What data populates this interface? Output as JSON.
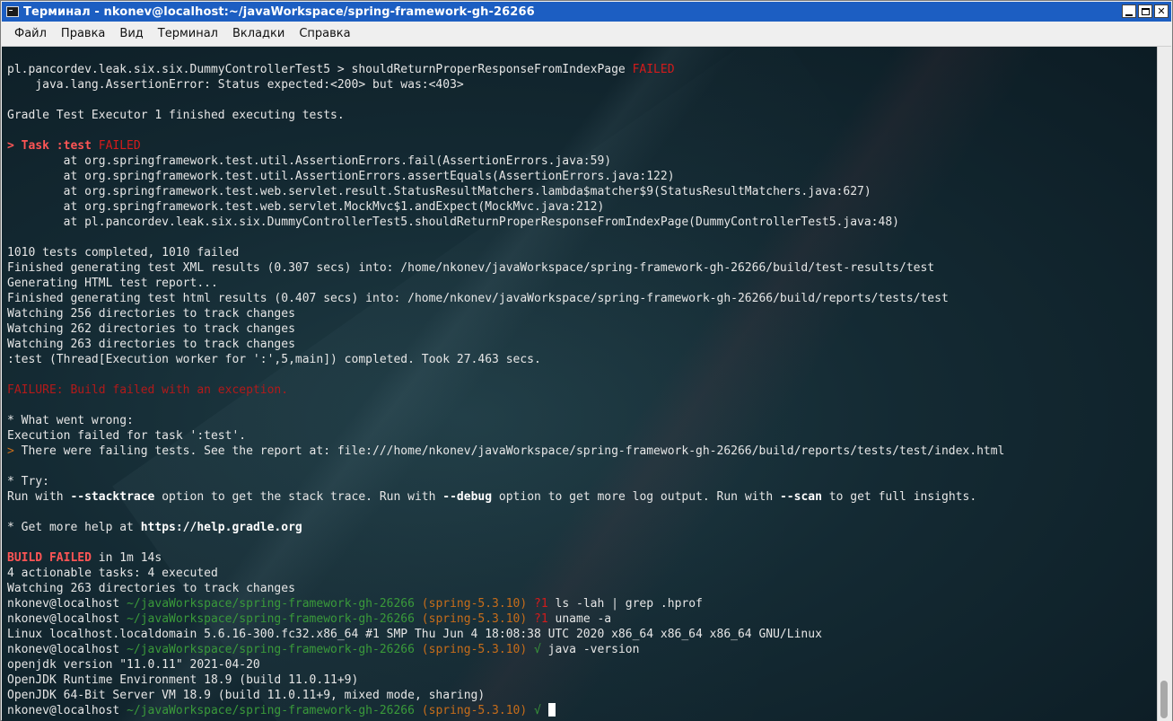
{
  "window": {
    "title": "Терминал - nkonev@localhost:~/javaWorkspace/spring-framework-gh-26266",
    "icon": "terminal-icon",
    "controls": {
      "minimize": "minimize-icon",
      "maximize": "maximize-icon",
      "close": "✕"
    }
  },
  "menu": [
    "Файл",
    "Правка",
    "Вид",
    "Терминал",
    "Вкладки",
    "Справка"
  ],
  "terminal": {
    "lines": [
      [
        {
          "t": "pl.pancordev.leak.six.six.DummyControllerTest5 > shouldReturnProperResponseFromIndexPage "
        },
        {
          "t": "FAILED",
          "c": "red"
        }
      ],
      [
        {
          "t": "    java.lang.AssertionError: Status expected:<200> but was:<403>"
        }
      ],
      [],
      [
        {
          "t": "Gradle Test Executor 1 finished executing tests."
        }
      ],
      [],
      [
        {
          "t": "> Task :test ",
          "c": "red-b"
        },
        {
          "t": "FAILED",
          "c": "red"
        }
      ],
      [
        {
          "t": "        at org.springframework.test.util.AssertionErrors.fail(AssertionErrors.java:59)"
        }
      ],
      [
        {
          "t": "        at org.springframework.test.util.AssertionErrors.assertEquals(AssertionErrors.java:122)"
        }
      ],
      [
        {
          "t": "        at org.springframework.test.web.servlet.result.StatusResultMatchers.lambda$matcher$9(StatusResultMatchers.java:627)"
        }
      ],
      [
        {
          "t": "        at org.springframework.test.web.servlet.MockMvc$1.andExpect(MockMvc.java:212)"
        }
      ],
      [
        {
          "t": "        at pl.pancordev.leak.six.six.DummyControllerTest5.shouldReturnProperResponseFromIndexPage(DummyControllerTest5.java:48)"
        }
      ],
      [],
      [
        {
          "t": "1010 tests completed, 1010 failed"
        }
      ],
      [
        {
          "t": "Finished generating test XML results (0.307 secs) into: /home/nkonev/javaWorkspace/spring-framework-gh-26266/build/test-results/test"
        }
      ],
      [
        {
          "t": "Generating HTML test report..."
        }
      ],
      [
        {
          "t": "Finished generating test html results (0.407 secs) into: /home/nkonev/javaWorkspace/spring-framework-gh-26266/build/reports/tests/test"
        }
      ],
      [
        {
          "t": "Watching 256 directories to track changes"
        }
      ],
      [
        {
          "t": "Watching 262 directories to track changes"
        }
      ],
      [
        {
          "t": "Watching 263 directories to track changes"
        }
      ],
      [
        {
          "t": ":test (Thread[Execution worker for ':',5,main]) completed. Took 27.463 secs."
        }
      ],
      [],
      [
        {
          "t": "FAILURE: Build failed with an exception.",
          "c": "red-dim"
        }
      ],
      [],
      [
        {
          "t": "* What went wrong:"
        }
      ],
      [
        {
          "t": "Execution failed for task ':test'."
        }
      ],
      [
        {
          "t": "> ",
          "c": "orange"
        },
        {
          "t": "There were failing tests. See the report at: file:///home/nkonev/javaWorkspace/spring-framework-gh-26266/build/reports/tests/test/index.html"
        }
      ],
      [],
      [
        {
          "t": "* Try:"
        }
      ],
      [
        {
          "t": "Run with "
        },
        {
          "t": "--stacktrace",
          "c": "bold"
        },
        {
          "t": " option to get the stack trace. Run with "
        },
        {
          "t": "--debug",
          "c": "bold"
        },
        {
          "t": " option to get more log output. Run with "
        },
        {
          "t": "--scan",
          "c": "bold"
        },
        {
          "t": " to get full insights."
        }
      ],
      [],
      [
        {
          "t": "* Get more help at "
        },
        {
          "t": "https://help.gradle.org",
          "c": "bold"
        }
      ],
      [],
      [
        {
          "t": "BUILD FAILED",
          "c": "red-b"
        },
        {
          "t": " in 1m 14s"
        }
      ],
      [
        {
          "t": "4 actionable tasks: 4 executed"
        }
      ],
      [
        {
          "t": "Watching 263 directories to track changes"
        }
      ],
      [
        {
          "t": "nkonev@localhost "
        },
        {
          "t": "~/javaWorkspace/spring-framework-gh-26266",
          "c": "green"
        },
        {
          "t": " (spring-5.3.10)",
          "c": "orange"
        },
        {
          "t": " ?1",
          "c": "red"
        },
        {
          "t": " ls -lah | grep .hprof"
        }
      ],
      [
        {
          "t": "nkonev@localhost "
        },
        {
          "t": "~/javaWorkspace/spring-framework-gh-26266",
          "c": "green"
        },
        {
          "t": " (spring-5.3.10)",
          "c": "orange"
        },
        {
          "t": " ?1",
          "c": "red"
        },
        {
          "t": " uname -a"
        }
      ],
      [
        {
          "t": "Linux localhost.localdomain 5.6.16-300.fc32.x86_64 #1 SMP Thu Jun 4 18:08:38 UTC 2020 x86_64 x86_64 x86_64 GNU/Linux"
        }
      ],
      [
        {
          "t": "nkonev@localhost "
        },
        {
          "t": "~/javaWorkspace/spring-framework-gh-26266",
          "c": "green"
        },
        {
          "t": " (spring-5.3.10)",
          "c": "orange"
        },
        {
          "t": " √",
          "c": "green"
        },
        {
          "t": " java -version"
        }
      ],
      [
        {
          "t": "openjdk version \"11.0.11\" 2021-04-20"
        }
      ],
      [
        {
          "t": "OpenJDK Runtime Environment 18.9 (build 11.0.11+9)"
        }
      ],
      [
        {
          "t": "OpenJDK 64-Bit Server VM 18.9 (build 11.0.11+9, mixed mode, sharing)"
        }
      ],
      [
        {
          "t": "nkonev@localhost "
        },
        {
          "t": "~/javaWorkspace/spring-framework-gh-26266",
          "c": "green"
        },
        {
          "t": " (spring-5.3.10)",
          "c": "orange"
        },
        {
          "t": " √",
          "c": "green"
        },
        {
          "t": " "
        },
        {
          "cursor": true
        }
      ]
    ]
  },
  "colors": {
    "titlebar": "#1c5ec2",
    "terminal_bg": "#142a33",
    "text": "#e6e6e6",
    "error_red": "#d41b1b",
    "path_green": "#3a9a3a",
    "branch_orange": "#c76d1a"
  }
}
